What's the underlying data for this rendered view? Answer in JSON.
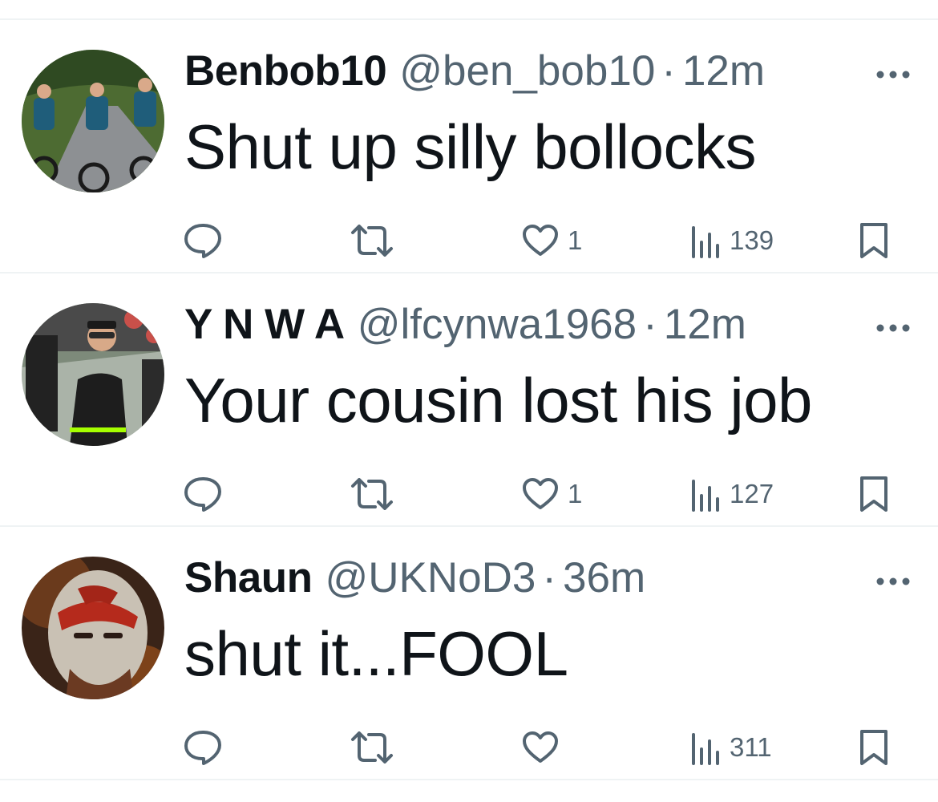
{
  "colors": {
    "text_primary": "#0f1419",
    "text_secondary": "#536471",
    "divider": "#eff3f4",
    "background": "#ffffff"
  },
  "tweets": [
    {
      "name": "Benbob10",
      "handle": "@ben_bob10",
      "separator": "·",
      "time": "12m",
      "text": "Shut up silly bollocks",
      "likes": "1",
      "views": "139",
      "avatar": "cyclists-avatar"
    },
    {
      "name": "Y N W A",
      "handle": "@lfcynwa1968",
      "separator": "·",
      "time": "12m",
      "text": "Your cousin lost his job",
      "likes": "1",
      "views": "127",
      "avatar": "manager-avatar"
    },
    {
      "name": "Shaun",
      "handle": "@UKNoD3",
      "separator": "·",
      "time": "36m",
      "text": "shut it...FOOL",
      "likes": "",
      "views": "311",
      "avatar": "warrior-avatar"
    }
  ],
  "icons": {
    "more": "more-icon",
    "reply": "reply-icon",
    "retweet": "retweet-icon",
    "like": "heart-icon",
    "views": "views-icon",
    "bookmark": "bookmark-icon"
  }
}
